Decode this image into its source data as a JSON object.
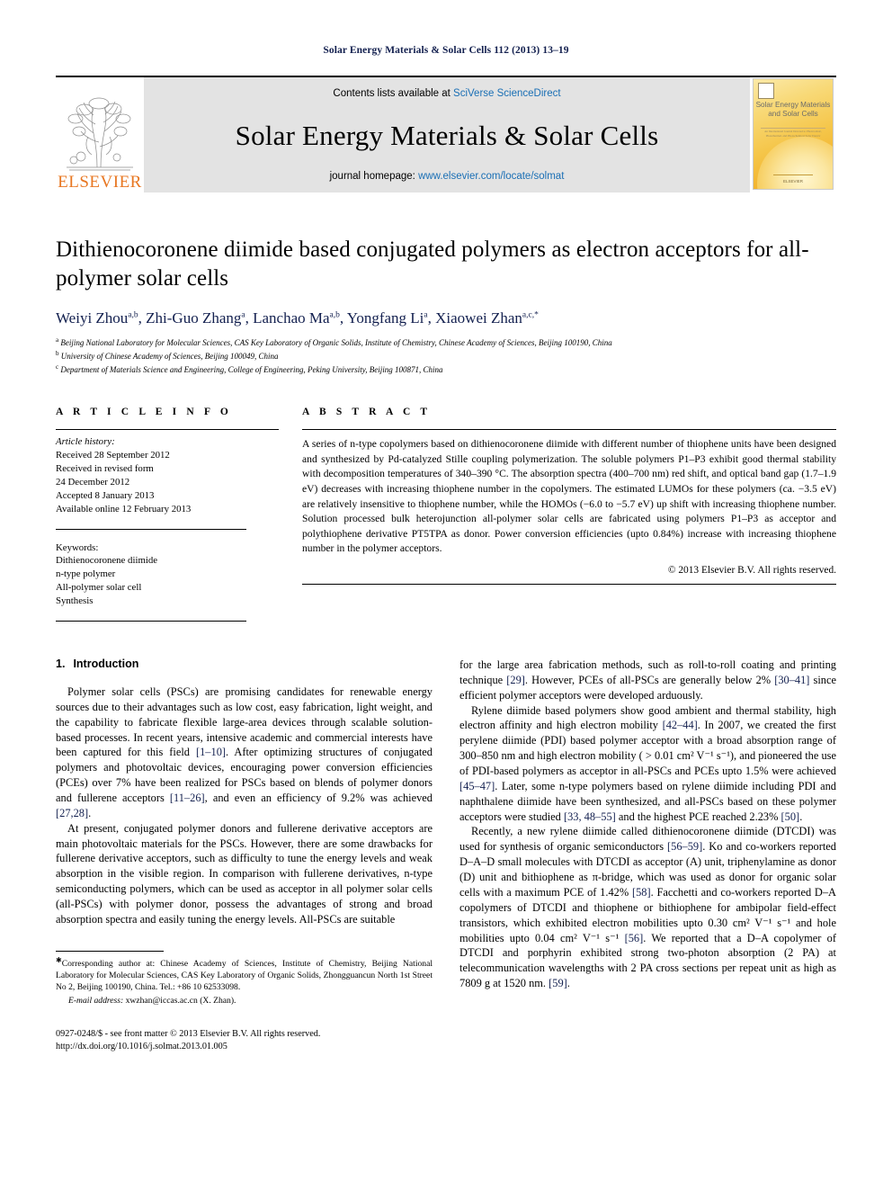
{
  "running_head": "Solar Energy Materials & Solar Cells 112 (2013) 13–19",
  "masthead": {
    "publisher_name": "ELSEVIER",
    "contents_prefix": "Contents lists available at ",
    "contents_link": "SciVerse ScienceDirect",
    "journal_title": "Solar Energy Materials & Solar Cells",
    "homepage_prefix": "journal homepage: ",
    "homepage_url": "www.elsevier.com/locate/solmat",
    "cover": {
      "title_line1": "Solar Energy Materials",
      "title_line2": "and Solar Cells",
      "subtitle": "An International Journal Devoted to Photovoltaic, Photothermal, and Photochemical Solar Energy Conversion",
      "footer": "ELSEVIER"
    }
  },
  "article": {
    "title": "Dithienocoronene diimide based conjugated polymers as electron acceptors for all-polymer solar cells",
    "authors": [
      {
        "name": "Weiyi Zhou",
        "sup": "a,b"
      },
      {
        "name": "Zhi-Guo Zhang",
        "sup": "a"
      },
      {
        "name": "Lanchao Ma",
        "sup": "a,b"
      },
      {
        "name": "Yongfang Li",
        "sup": "a"
      },
      {
        "name": "Xiaowei Zhan",
        "sup": "a,c,*"
      }
    ],
    "affiliations": [
      {
        "mark": "a",
        "text": "Beijing National Laboratory for Molecular Sciences, CAS Key Laboratory of Organic Solids, Institute of Chemistry, Chinese Academy of Sciences, Beijing 100190, China"
      },
      {
        "mark": "b",
        "text": "University of Chinese Academy of Sciences, Beijing 100049, China"
      },
      {
        "mark": "c",
        "text": "Department of Materials Science and Engineering, College of Engineering, Peking University, Beijing 100871, China"
      }
    ]
  },
  "article_info": {
    "heading": "A R T I C L E   I N F O",
    "history_label": "Article history:",
    "history": [
      "Received 28 September 2012",
      "Received in revised form",
      "24 December 2012",
      "Accepted 8 January 2013",
      "Available online 12 February 2013"
    ],
    "keywords_label": "Keywords:",
    "keywords": [
      "Dithienocoronene diimide",
      "n-type polymer",
      "All-polymer solar cell",
      "Synthesis"
    ]
  },
  "abstract": {
    "heading": "A B S T R A C T",
    "text": "A series of n-type copolymers based on dithienocoronene diimide with different number of thiophene units have been designed and synthesized by Pd-catalyzed Stille coupling polymerization. The soluble polymers P1–P3 exhibit good thermal stability with decomposition temperatures of 340–390 °C. The absorption spectra (400–700 nm) red shift, and optical band gap (1.7–1.9 eV) decreases with increasing thiophene number in the copolymers. The estimated LUMOs for these polymers (ca. −3.5 eV) are relatively insensitive to thiophene number, while the HOMOs (−6.0 to −5.7 eV) up shift with increasing thiophene number. Solution processed bulk heterojunction all-polymer solar cells are fabricated using polymers P1–P3 as acceptor and polythiophene derivative PT5TPA as donor. Power conversion efficiencies (upto 0.84%) increase with increasing thiophene number in the polymer acceptors.",
    "copyright": "© 2013 Elsevier B.V. All rights reserved."
  },
  "section": {
    "number": "1.",
    "title": "Introduction"
  },
  "left_column_paragraphs": [
    "Polymer solar cells (PSCs) are promising candidates for renewable energy sources due to their advantages such as low cost, easy fabrication, light weight, and the capability to fabricate flexible large-area devices through scalable solution-based processes. In recent years, intensive academic and commercial interests have been captured for this field [1–10]. After optimizing structures of conjugated polymers and photovoltaic devices, encouraging power conversion efficiencies (PCEs) over 7% have been realized for PSCs based on blends of polymer donors and fullerene acceptors [11–26], and even an efficiency of 9.2% was achieved [27,28].",
    "At present, conjugated polymer donors and fullerene derivative acceptors are main photovoltaic materials for the PSCs. However, there are some drawbacks for fullerene derivative acceptors, such as difficulty to tune the energy levels and weak absorption in the visible region. In comparison with fullerene derivatives, n-type semiconducting polymers, which can be used as acceptor in all polymer solar cells (all-PSCs) with polymer donor, possess the advantages of strong and broad absorption spectra and easily tuning the energy levels. All-PSCs are suitable"
  ],
  "right_column_paragraphs": [
    "for the large area fabrication methods, such as roll-to-roll coating and printing technique [29]. However, PCEs of all-PSCs are generally below 2% [30–41] since efficient polymer acceptors were developed arduously.",
    "Rylene diimide based polymers show good ambient and thermal stability, high electron affinity and high electron mobility [42–44]. In 2007, we created the first perylene diimide (PDI) based polymer acceptor with a broad absorption range of 300–850 nm and high electron mobility ( > 0.01 cm² V⁻¹ s⁻¹), and pioneered the use of PDI-based polymers as acceptor in all-PSCs and PCEs upto 1.5% were achieved [45–47]. Later, some n-type polymers based on rylene diimide including PDI and naphthalene diimide have been synthesized, and all-PSCs based on these polymer acceptors were studied [33, 48–55] and the highest PCE reached 2.23% [50].",
    "Recently, a new rylene diimide called dithienocoronene diimide (DTCDI) was used for synthesis of organic semiconductors [56–59]. Ko and co-workers reported D–A–D small molecules with DTCDI as acceptor (A) unit, triphenylamine as donor (D) unit and bithiophene as π-bridge, which was used as donor for organic solar cells with a maximum PCE of 1.42% [58]. Facchetti and co-workers reported D–A copolymers of DTCDI and thiophene or bithiophene for ambipolar field-effect transistors, which exhibited electron mobilities upto 0.30 cm² V⁻¹ s⁻¹ and hole mobilities upto 0.04 cm² V⁻¹ s⁻¹ [56]. We reported that a D–A copolymer of DTCDI and porphyrin exhibited strong two-photon absorption (2 PA) at telecommunication wavelengths with 2 PA cross sections per repeat unit as high as 7809 g at 1520 nm. [59]."
  ],
  "footnote": {
    "corresponding": "Corresponding author at: Chinese Academy of Sciences, Institute of Chemistry, Beijing National Laboratory for Molecular Sciences, CAS Key Laboratory of Organic Solids, Zhongguancun North 1st Street No 2, Beijing 100190, China. Tel.: +86 10 62533098.",
    "email_label": "E-mail address:",
    "email": "xwzhan@iccas.ac.cn (X. Zhan)."
  },
  "colophon": {
    "issn_line": "0927-0248/$ - see front matter © 2013 Elsevier B.V. All rights reserved.",
    "doi_line": "http://dx.doi.org/10.1016/j.solmat.2013.01.005"
  },
  "colors": {
    "link": "#1a6fb5",
    "reference": "#13204f",
    "elsevier_orange": "#e87722",
    "masthead_bg": "#e3e3e3"
  }
}
